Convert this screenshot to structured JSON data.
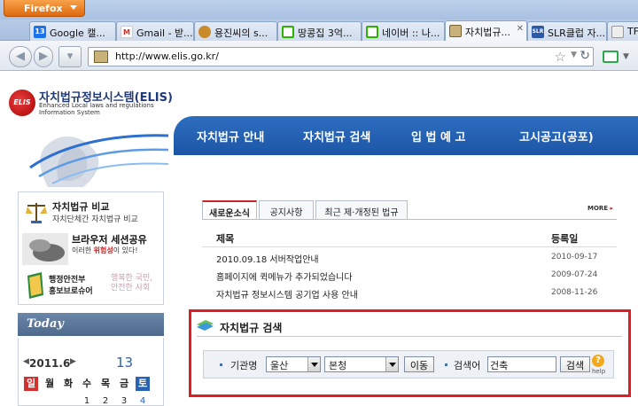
{
  "browser": {
    "app_menu": "Firefox",
    "tabs": [
      {
        "label": "Google 캘...",
        "icon": "google-calendar-icon",
        "color": "#1a73e8",
        "icon_text": "13"
      },
      {
        "label": "Gmail - 받...",
        "icon": "gmail-icon",
        "color": "#d93025",
        "icon_text": "M"
      },
      {
        "label": "용진씨의 s...",
        "icon": "blog-icon",
        "color": "#c98a2a",
        "icon_text": ""
      },
      {
        "label": "땅콩집 3억...",
        "icon": "naver-icon",
        "color": "#2db400",
        "icon_text": ""
      },
      {
        "label": "네이버 :: 나...",
        "icon": "naver-icon",
        "color": "#2db400",
        "icon_text": ""
      },
      {
        "label": "자치법규...",
        "icon": "elis-icon",
        "color": "#b08a3a",
        "icon_text": ""
      },
      {
        "label": "SLR클럽 자...",
        "icon": "slr-icon",
        "color": "#2a5aa8",
        "icon_text": "SLR"
      },
      {
        "label": "TF",
        "icon": "page-icon",
        "color": "#888888",
        "icon_text": ""
      }
    ],
    "url": "http://www.elis.go.kr/"
  },
  "site": {
    "logo_badge": "ELIS",
    "logo_title": "자치법규정보시스템(ELIS)",
    "logo_sub_1": "Enhanced Local laws and regulations",
    "logo_sub_2": "Information System",
    "menu": [
      "자치법규 안내",
      "자치법규 검색",
      "입 법 예 고",
      "고시공고(공포)"
    ]
  },
  "sidebar": {
    "compare_title": "자치법규 비교",
    "compare_sub": "자치단체간 자치법규 비교",
    "session_title": "브라우저 세션공유",
    "session_sub_a": "이러한 ",
    "session_sub_red": "위험성",
    "session_sub_b": "이 있다!",
    "brochure_1": "행정안전부",
    "brochure_2": "홍보브로슈어",
    "brochure_slogan": "행복한 국민, 안전한 사회",
    "today": "Today",
    "calendar_month": "2011.6",
    "calendar_day": "13",
    "weekdays": [
      "일",
      "월",
      "화",
      "수",
      "목",
      "금",
      "토"
    ],
    "first_dates": [
      "1",
      "2",
      "3",
      "4"
    ]
  },
  "notices": {
    "tabs": [
      "새로운소식",
      "공지사항",
      "최근 제·개정된 법규"
    ],
    "more": "MORE",
    "col_title": "제목",
    "col_date": "등록일",
    "rows": [
      {
        "title": "2010.09.18 서버작업안내",
        "date": "2010-09-17"
      },
      {
        "title": "홈페이지에 퀵메뉴가 추가되었습니다",
        "date": "2009-07-24"
      },
      {
        "title": "자치법규 정보시스템 공기업 사용 안내",
        "date": "2008-11-26"
      }
    ]
  },
  "search": {
    "title": "자치법규 검색",
    "org_label": "기관명",
    "org_select_1": "울산",
    "org_select_2": "본청",
    "move_button": "이동",
    "keyword_label": "검색어",
    "keyword_value": "건축",
    "search_button": "검색",
    "help": "help",
    "highlight_color": "#e11c23"
  }
}
